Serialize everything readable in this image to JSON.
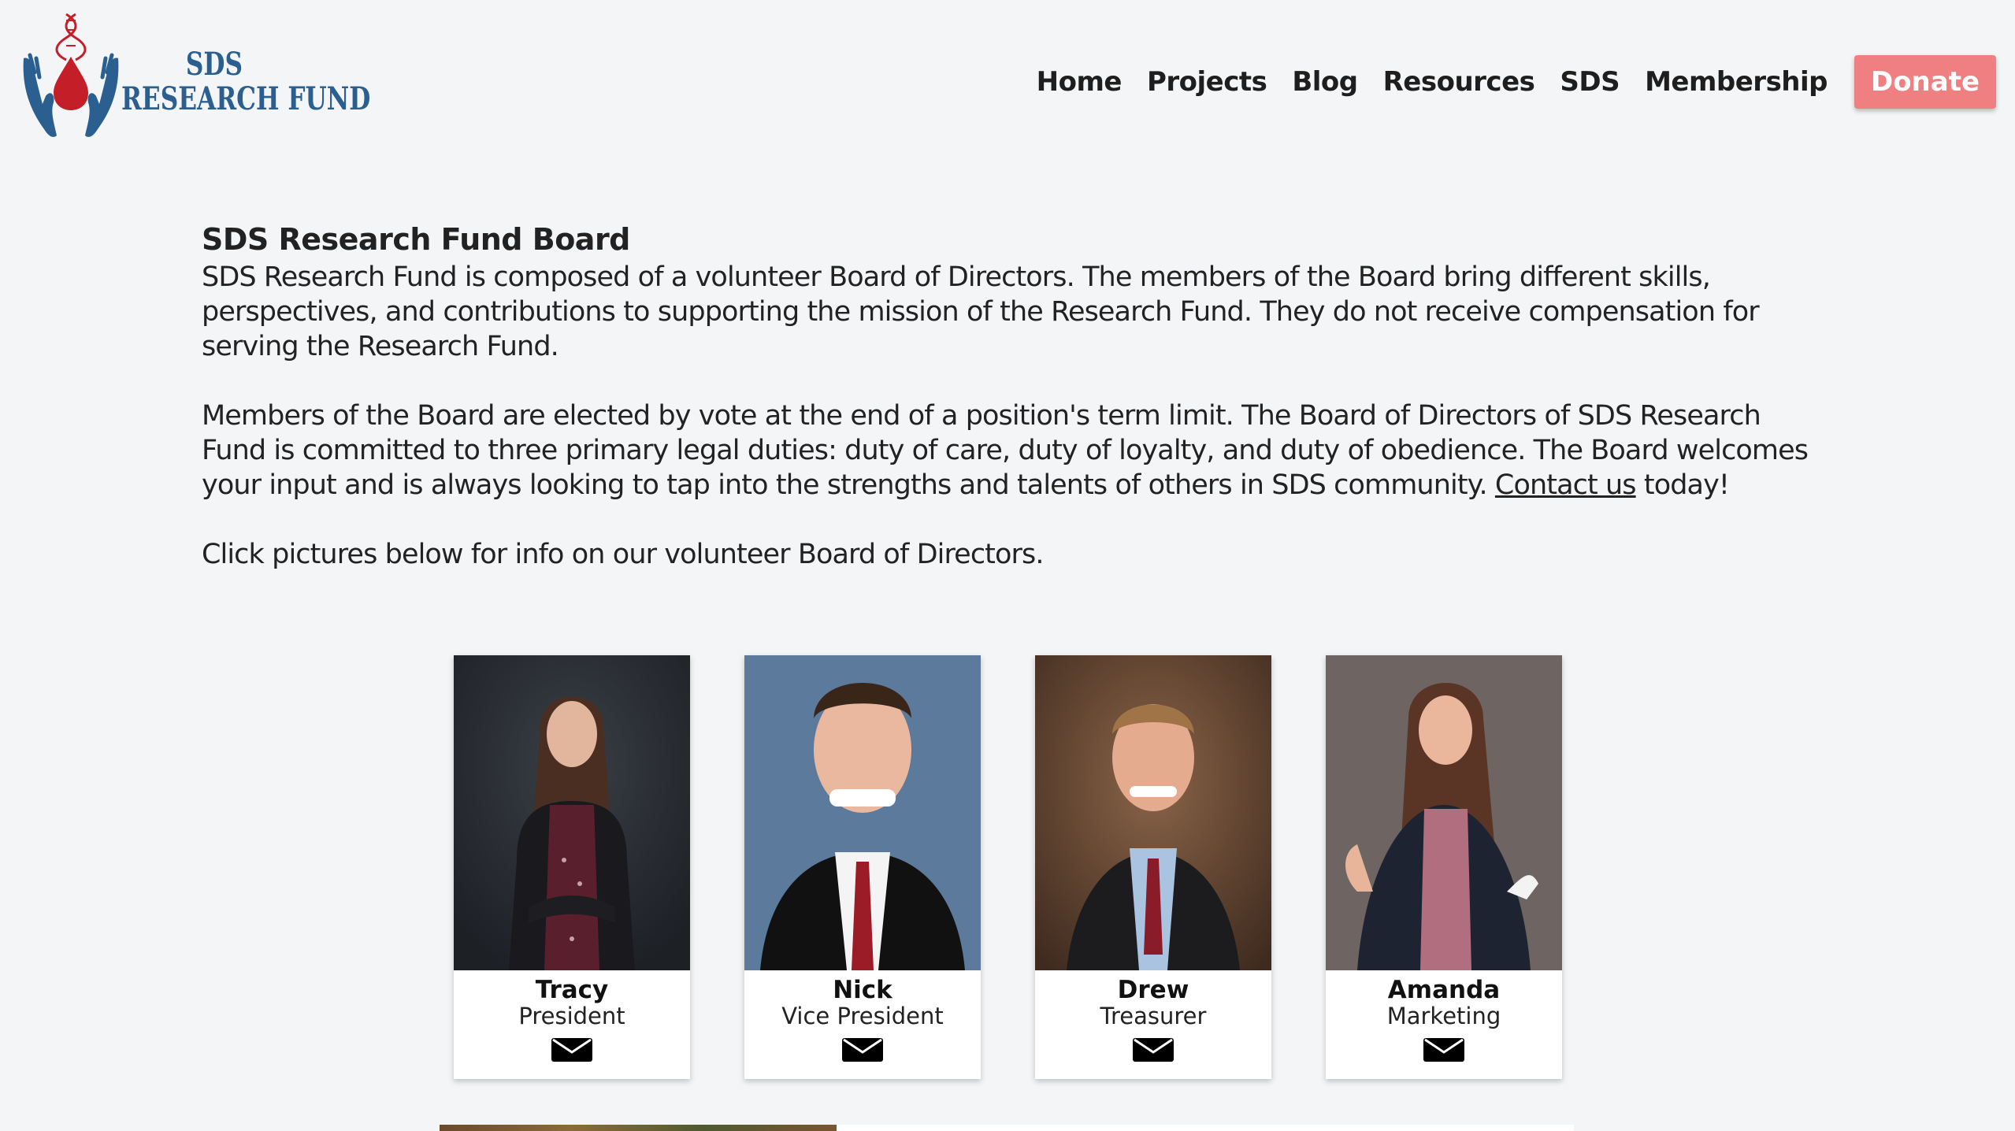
{
  "site": {
    "logo_line1": "SDS",
    "logo_line2": "RESEARCH FUND"
  },
  "nav": {
    "items": [
      "Home",
      "Projects",
      "Blog",
      "Resources",
      "SDS",
      "Membership"
    ],
    "donate_label": "Donate"
  },
  "intro": {
    "title": "SDS Research Fund Board",
    "paragraph1": "SDS Research Fund is composed of a volunteer Board of Directors. The members of the Board bring different skills, perspectives, and contributions to supporting the mission of the Research Fund. They do not receive compensation for serving the Research Fund.",
    "paragraph2_before_link": "Members of the Board are elected by vote at the end of a position's term limit. The Board of Directors of SDS Research Fund is committed to three primary legal duties: duty of care, duty of loyalty, and duty of obedience. The Board welcomes your input and is always looking to tap into the strengths and talents of others in SDS community. ",
    "contact_link": "Contact us",
    "paragraph2_after_link": " today!",
    "paragraph3": "Click pictures below for info on our volunteer Board of Directors."
  },
  "board": [
    {
      "name": "Tracy",
      "role": "President"
    },
    {
      "name": "Nick",
      "role": "Vice President"
    },
    {
      "name": "Drew",
      "role": "Treasurer"
    },
    {
      "name": "Amanda",
      "role": "Marketing"
    }
  ],
  "colors": {
    "accent": "#ef7f80",
    "logo_blue": "#2a5f8f",
    "logo_red": "#c41e28",
    "background": "#f4f5f7"
  }
}
